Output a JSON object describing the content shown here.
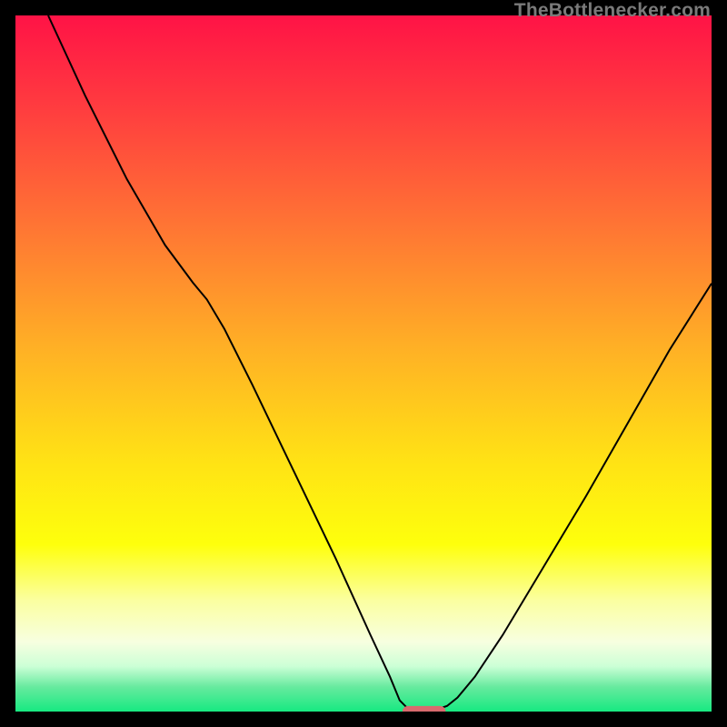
{
  "watermark": "TheBottlenecker.com",
  "chart_data": {
    "type": "line",
    "title": "",
    "xlabel": "",
    "ylabel": "",
    "xlim": [
      0,
      100
    ],
    "ylim": [
      0,
      100
    ],
    "axes_visible": false,
    "background": {
      "type": "vertical-gradient",
      "stops": [
        {
          "offset": 0.0,
          "color": "#ff1346"
        },
        {
          "offset": 0.12,
          "color": "#ff3840"
        },
        {
          "offset": 0.3,
          "color": "#ff7434"
        },
        {
          "offset": 0.48,
          "color": "#ffb125"
        },
        {
          "offset": 0.64,
          "color": "#ffe215"
        },
        {
          "offset": 0.76,
          "color": "#feff0c"
        },
        {
          "offset": 0.84,
          "color": "#fbffa0"
        },
        {
          "offset": 0.9,
          "color": "#f7ffe0"
        },
        {
          "offset": 0.935,
          "color": "#ccffd6"
        },
        {
          "offset": 0.965,
          "color": "#66ea9e"
        },
        {
          "offset": 1.0,
          "color": "#17e981"
        }
      ]
    },
    "series": [
      {
        "name": "bottleneck-curve",
        "stroke": "#000000",
        "stroke_width": 2,
        "points_xy": [
          [
            4.7,
            100.0
          ],
          [
            10.0,
            88.5
          ],
          [
            16.0,
            76.5
          ],
          [
            21.5,
            67.0
          ],
          [
            25.5,
            61.6
          ],
          [
            27.5,
            59.2
          ],
          [
            30.0,
            55.0
          ],
          [
            34.0,
            47.0
          ],
          [
            40.0,
            34.5
          ],
          [
            46.0,
            22.0
          ],
          [
            51.0,
            11.0
          ],
          [
            53.8,
            5.0
          ],
          [
            55.2,
            1.6
          ],
          [
            56.2,
            0.6
          ],
          [
            57.5,
            0.3
          ],
          [
            60.5,
            0.3
          ],
          [
            62.0,
            0.8
          ],
          [
            63.5,
            2.0
          ],
          [
            66.0,
            5.0
          ],
          [
            70.0,
            11.0
          ],
          [
            76.0,
            21.0
          ],
          [
            82.0,
            31.0
          ],
          [
            88.0,
            41.5
          ],
          [
            94.0,
            52.0
          ],
          [
            100.0,
            61.5
          ]
        ]
      }
    ],
    "marker": {
      "name": "optimal-range",
      "shape": "capsule",
      "fill": "#d86a6e",
      "cx": 58.7,
      "cy": 0.0,
      "width": 6.2,
      "height": 1.6
    }
  }
}
